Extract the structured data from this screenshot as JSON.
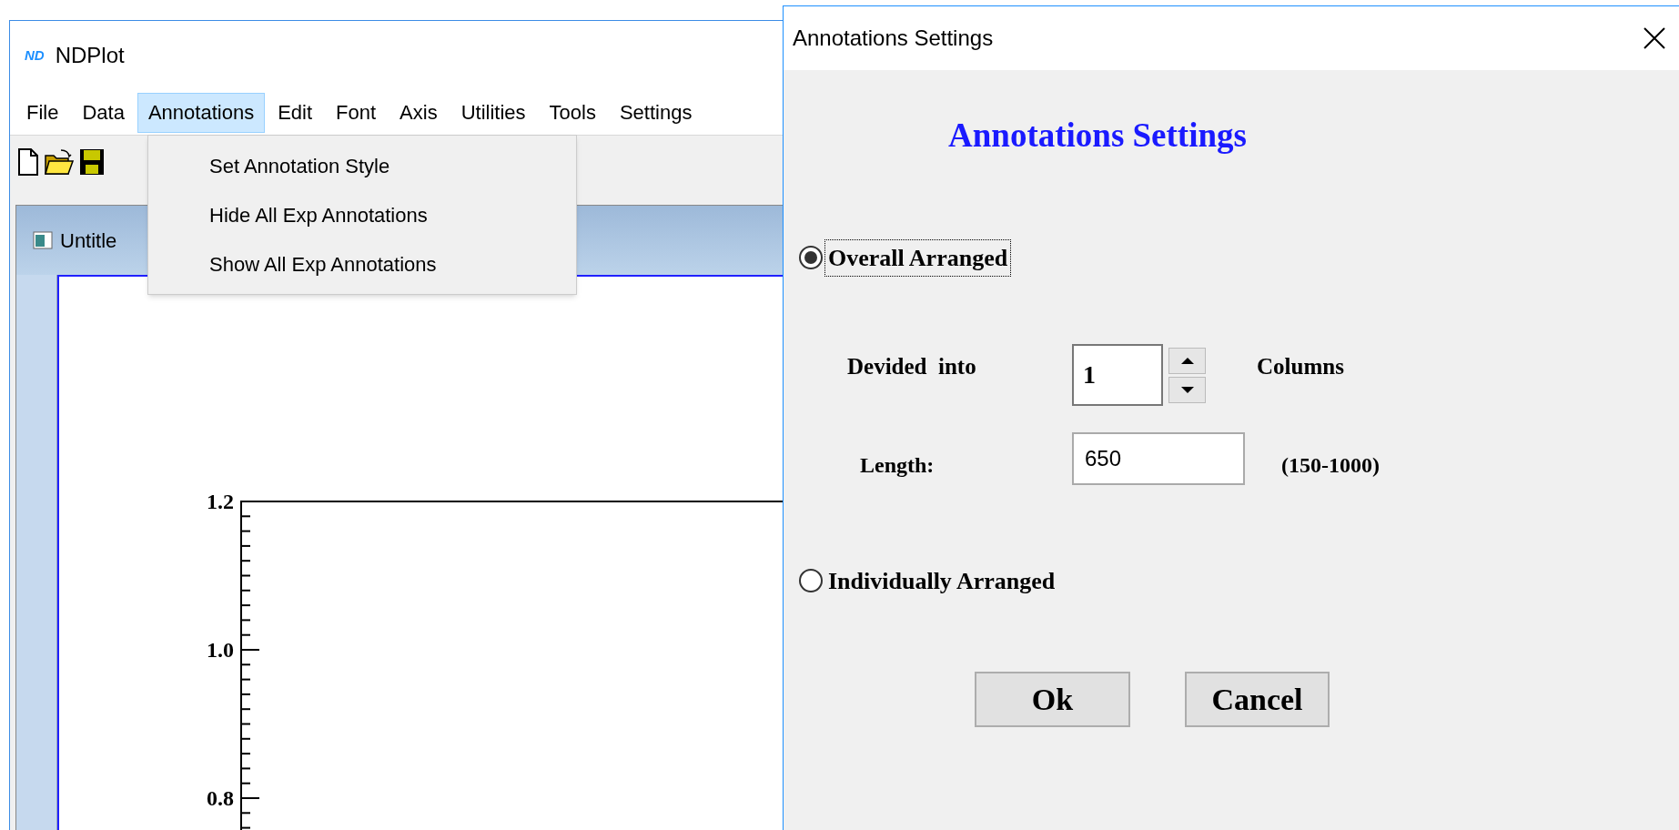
{
  "main_window": {
    "logo": "ND",
    "title": "NDPlot",
    "menu": [
      {
        "label": "File",
        "selected": false
      },
      {
        "label": "Data",
        "selected": false
      },
      {
        "label": "Annotations",
        "selected": true
      },
      {
        "label": "Edit",
        "selected": false
      },
      {
        "label": "Font",
        "selected": false
      },
      {
        "label": "Axis",
        "selected": false
      },
      {
        "label": "Utilities",
        "selected": false
      },
      {
        "label": "Tools",
        "selected": false
      },
      {
        "label": "Settings",
        "selected": false
      }
    ],
    "open_menu": {
      "items": [
        "Set Annotation Style",
        "Hide All Exp Annotations",
        "Show All Exp Annotations"
      ]
    },
    "document": {
      "title": "Untitle",
      "axis_labels": [
        "1.2",
        "1.0",
        "0.8"
      ]
    }
  },
  "dialog": {
    "title": "Annotations Settings",
    "heading": "Annotations Settings",
    "options": [
      {
        "kind": "radio",
        "label": "Overall Arranged",
        "selected": true,
        "focused": true
      },
      {
        "kind": "radio",
        "label": "Individually Arranged",
        "selected": false,
        "focused": false
      }
    ],
    "columns": {
      "label": "Devided  into",
      "value": "1",
      "unit": "Columns"
    },
    "length": {
      "label": "Length:",
      "value": "650",
      "range": "(150-1000)"
    },
    "buttons": [
      "Ok",
      "Cancel"
    ]
  }
}
